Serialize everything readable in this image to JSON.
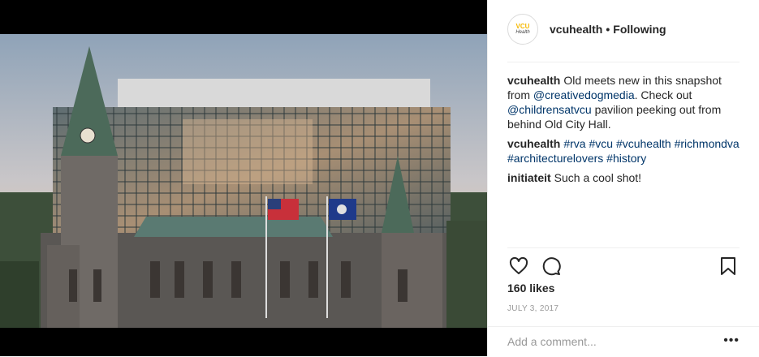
{
  "post": {
    "username": "vcuhealth",
    "separator": "•",
    "follow_status": "Following",
    "avatar": {
      "line1": "VCU",
      "line2": "Health"
    },
    "comments": [
      {
        "user": "vcuhealth",
        "parts": [
          {
            "text": "Old meets new in this snapshot from ",
            "link": false
          },
          {
            "text": "@creativedogmedia",
            "link": true
          },
          {
            "text": ". Check out ",
            "link": false
          },
          {
            "text": "@childrensatvcu",
            "link": true
          },
          {
            "text": " pavilion peeking out from behind Old City Hall.",
            "link": false
          }
        ]
      },
      {
        "user": "vcuhealth",
        "parts": [
          {
            "text": "#rva",
            "link": true
          },
          {
            "text": " ",
            "link": false
          },
          {
            "text": "#vcu",
            "link": true
          },
          {
            "text": " ",
            "link": false
          },
          {
            "text": "#vcuhealth",
            "link": true
          },
          {
            "text": " ",
            "link": false
          },
          {
            "text": "#richmondva",
            "link": true
          },
          {
            "text": " ",
            "link": false
          },
          {
            "text": "#architecturelovers",
            "link": true
          },
          {
            "text": " ",
            "link": false
          },
          {
            "text": "#history",
            "link": true
          }
        ]
      },
      {
        "user": "initiateit",
        "parts": [
          {
            "text": "Such a cool shot!",
            "link": false
          }
        ]
      }
    ],
    "likes": "160 likes",
    "date": "JULY 3, 2017",
    "comment_placeholder": "Add a comment...",
    "more_label": "•••"
  },
  "icons": {
    "like": "heart-icon",
    "comment": "comment-bubble-icon",
    "save": "bookmark-icon",
    "more": "more-options-icon"
  }
}
